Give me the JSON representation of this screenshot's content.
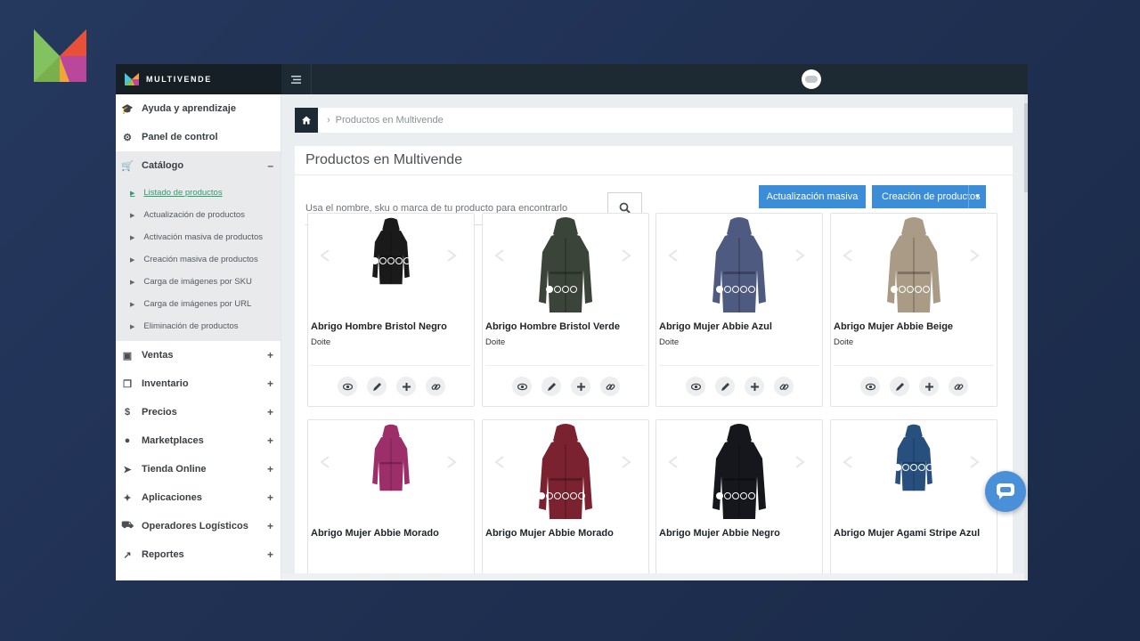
{
  "app": {
    "brand_name": "MULTIVENDE"
  },
  "colors": {
    "accent": "#3c8dd8",
    "sidebar_dark": "#1d2a33",
    "active_link": "#2f9c6a"
  },
  "sidebar": {
    "items": [
      {
        "label": "Ayuda y aprendizaje",
        "icon": "graduation-cap-icon"
      },
      {
        "label": "Panel de control",
        "icon": "dashboard-icon"
      },
      {
        "label": "Catálogo",
        "icon": "cart-icon",
        "toggle": "–"
      },
      {
        "label": "Ventas",
        "icon": "money-icon",
        "toggle": "+"
      },
      {
        "label": "Inventario",
        "icon": "cubes-icon",
        "toggle": "+"
      },
      {
        "label": "Precios",
        "icon": "dollar-icon",
        "toggle": "+"
      },
      {
        "label": "Marketplaces",
        "icon": "globe-icon",
        "toggle": "+"
      },
      {
        "label": "Tienda Online",
        "icon": "pointer-icon",
        "toggle": "+"
      },
      {
        "label": "Aplicaciones",
        "icon": "puzzle-icon",
        "toggle": "+"
      },
      {
        "label": "Operadores Logísticos",
        "icon": "truck-icon",
        "toggle": "+"
      },
      {
        "label": "Reportes",
        "icon": "chart-line-icon",
        "toggle": "+"
      }
    ],
    "catalog_submenu": [
      "Listado de productos",
      "Actualización de productos",
      "Activación masiva de productos",
      "Creación masiva de productos",
      "Carga de imágenes por SKU",
      "Carga de imágenes por URL",
      "Eliminación de productos"
    ]
  },
  "breadcrumb": {
    "current": "Productos en Multivende"
  },
  "panel": {
    "title": "Productos en Multivende",
    "search_placeholder": "Usa el nombre, sku o marca de tu producto para encontrarlo",
    "btn_mass_update": "Actualización masiva",
    "btn_create": "Creación de productos"
  },
  "products": [
    {
      "name": "Abrigo Hombre Bristol Negro",
      "brand": "Doite",
      "color": "#1a1a1a",
      "dots": 5
    },
    {
      "name": "Abrigo Hombre Bristol Verde",
      "brand": "Doite",
      "color": "#3b4438",
      "dots": 4
    },
    {
      "name": "Abrigo Mujer Abbie Azul",
      "brand": "Doite",
      "color": "#4f5a80",
      "dots": 5
    },
    {
      "name": "Abrigo Mujer Abbie Beige",
      "brand": "Doite",
      "color": "#a99b86",
      "dots": 5
    },
    {
      "name": "Abrigo Mujer Abbie Morado",
      "brand": "",
      "color": "#9c2e6a",
      "dots": 0
    },
    {
      "name": "Abrigo Mujer Abbie Morado",
      "brand": "",
      "color": "#7a2230",
      "dots": 6
    },
    {
      "name": "Abrigo Mujer Abbie Negro",
      "brand": "",
      "color": "#16171c",
      "dots": 5
    },
    {
      "name": "Abrigo Mujer Agami Stripe Azul",
      "brand": "",
      "color": "#27507e",
      "dots": 5
    }
  ]
}
